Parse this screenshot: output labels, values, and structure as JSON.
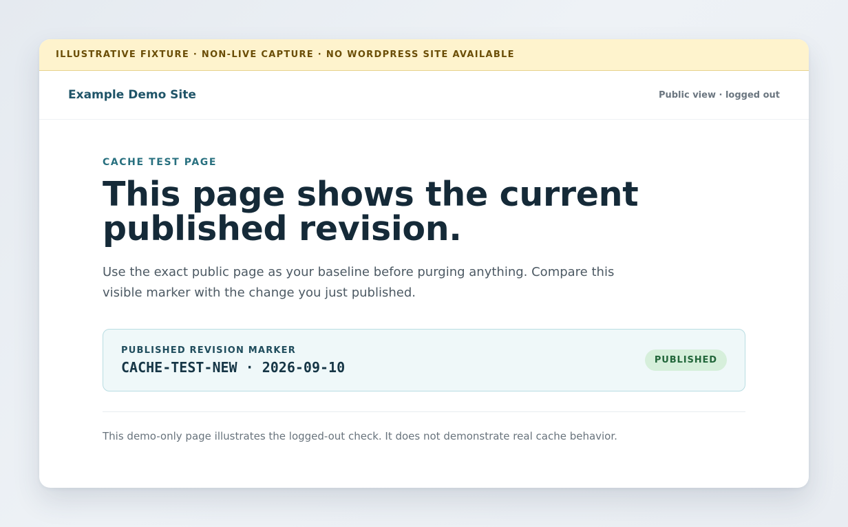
{
  "banner": {
    "text": "ILLUSTRATIVE FIXTURE · NON-LIVE CAPTURE · NO WORDPRESS SITE AVAILABLE"
  },
  "header": {
    "site_title": "Example Demo Site",
    "view_status": "Public view · logged out"
  },
  "main": {
    "eyebrow": "CACHE TEST PAGE",
    "headline": "This page shows the current published revision.",
    "lede": "Use the exact public page as your baseline before purging anything. Compare this visible marker with the change you just published.",
    "marker": {
      "label": "PUBLISHED REVISION MARKER",
      "value": "CACHE-TEST-NEW · 2026-09-10",
      "badge": "PUBLISHED"
    },
    "footnote": "This demo-only page illustrates the logged-out check. It does not demonstrate real cache behavior."
  },
  "colors": {
    "banner_background": "#fef3cd",
    "accent": "#28707f",
    "badge_background": "#d6efdb",
    "badge_text": "#22663a"
  }
}
